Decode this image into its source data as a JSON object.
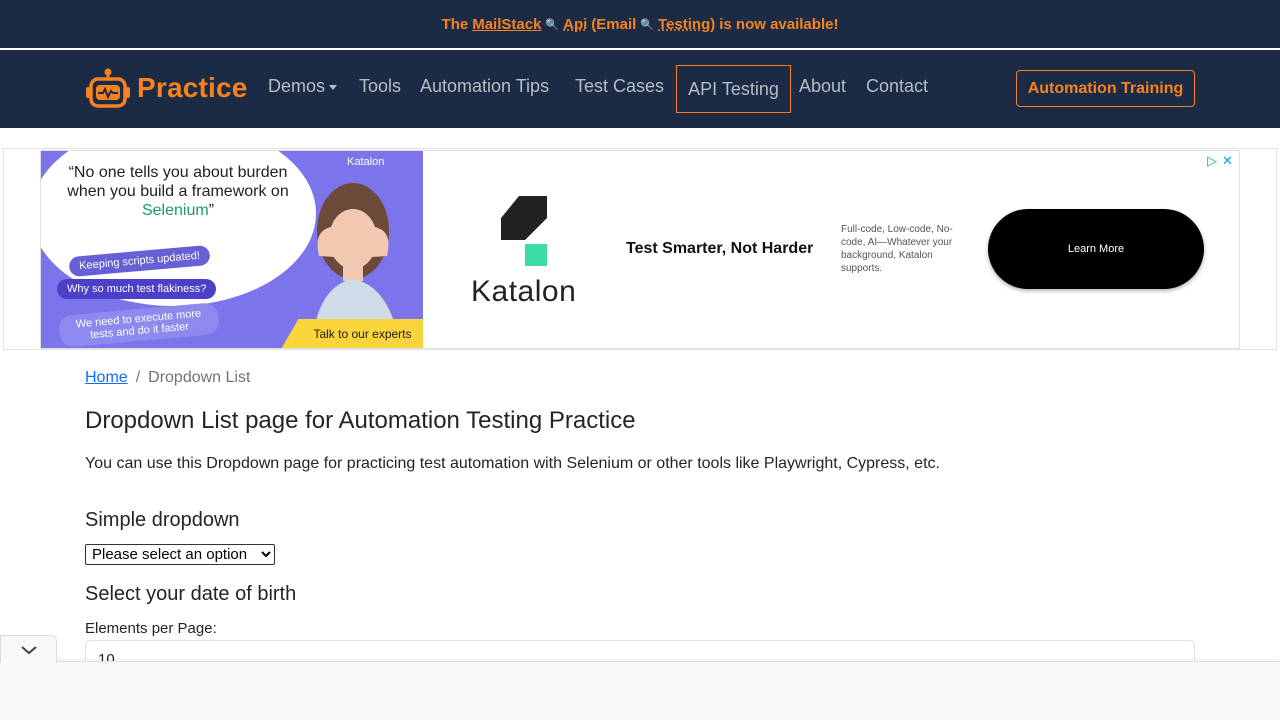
{
  "announcement": {
    "prefix": "The",
    "link1": "MailStack",
    "link2": "Api",
    "middle": "(Email",
    "link3": "Testing)",
    "suffix": "is now available!"
  },
  "navbar": {
    "brand": "Practice",
    "items": [
      "Demos",
      "Tools",
      "Automation Tips",
      "Test Cases",
      "API Testing",
      "About",
      "Contact"
    ],
    "cta": "Automation Training"
  },
  "ad": {
    "quote_part1": "“No one tells you about burden when you build a framework on",
    "quote_highlight": "Selenium",
    "quote_end": "”",
    "small_brand": "Katalon",
    "pill1": "Keeping scripts updated!",
    "pill2": "Why so much test flakiness?",
    "pill3": "We need to execute more tests and do it faster",
    "talk": "Talk to our experts",
    "brand_word": "Katalon",
    "headline": "Test Smarter, Not Harder",
    "subtext": "Full-code, Low-code, No-code, AI—Whatever your background, Katalon supports.",
    "button": "Learn More"
  },
  "breadcrumb": {
    "home": "Home",
    "sep": "/",
    "current": "Dropdown List"
  },
  "page": {
    "title": "Dropdown List page for Automation Testing Practice",
    "intro": "You can use this Dropdown page for practicing test automation with Selenium or other tools like Playwright, Cypress, etc.",
    "simple_heading": "Simple dropdown",
    "simple_value": "Please select an option",
    "dob_heading": "Select your date of birth",
    "epp_label": "Elements per Page:",
    "epp_value": "10"
  },
  "colors": {
    "navy": "#1b2b45",
    "orange": "#f5821f",
    "link": "#0d6efd"
  }
}
